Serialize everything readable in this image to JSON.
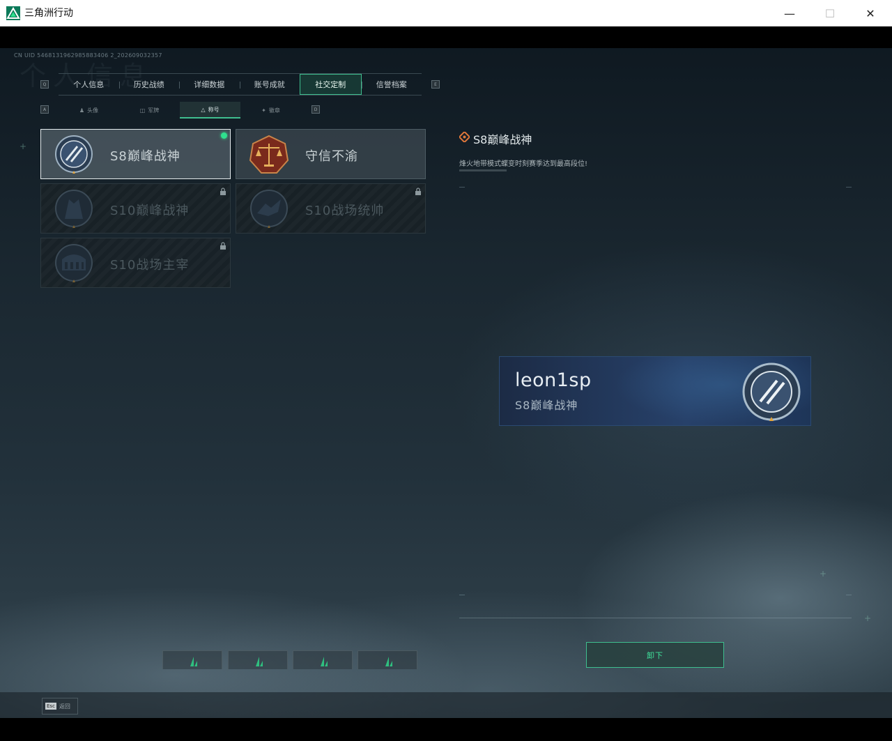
{
  "window": {
    "title": "三角洲行动",
    "minimize": "—",
    "maximize": "☐",
    "close": "✕"
  },
  "header": {
    "uid": "CN UID 5468131962985883406 2_202609032357",
    "background_title": "个人信息"
  },
  "tabs": {
    "left_key": "Q",
    "right_key": "E",
    "items": [
      {
        "label": "个人信息"
      },
      {
        "label": "历史战绩"
      },
      {
        "label": "详细数据"
      },
      {
        "label": "账号成就"
      },
      {
        "label": "社交定制"
      },
      {
        "label": "信誉档案"
      }
    ],
    "active_index": 4
  },
  "subtabs": {
    "left_key": "A",
    "right_key": "D",
    "items": [
      {
        "label": "头像",
        "icon": "person-icon"
      },
      {
        "label": "军牌",
        "icon": "dogtag-icon"
      },
      {
        "label": "称号",
        "icon": "triangle-icon"
      },
      {
        "label": "徽章",
        "icon": "emblem-icon"
      }
    ],
    "active_index": 2
  },
  "titles": [
    {
      "label": "S8巅峰战神",
      "state": "selected",
      "equipped": true
    },
    {
      "label": "守信不渝",
      "state": "available",
      "equipped": false
    },
    {
      "label": "S10巅峰战神",
      "state": "locked",
      "equipped": false
    },
    {
      "label": "S10战场统帅",
      "state": "locked",
      "equipped": false
    },
    {
      "label": "S10战场主宰",
      "state": "locked",
      "equipped": false
    }
  ],
  "detail": {
    "title": "S8巅峰战神",
    "description": "烽火地带模式蝶变时刻赛季达到最高段位!"
  },
  "nameplate": {
    "player_name": "leon1sp",
    "title": "S8巅峰战神"
  },
  "actions": {
    "unequip_label": "卸下"
  },
  "footer": {
    "esc_key": "Esc",
    "back_label": "返回"
  },
  "colors": {
    "accent": "#3fbf8f",
    "equipped_dot": "#2fe08e",
    "nameplate_bg": "#27416a",
    "detail_icon": "#e0773a"
  }
}
